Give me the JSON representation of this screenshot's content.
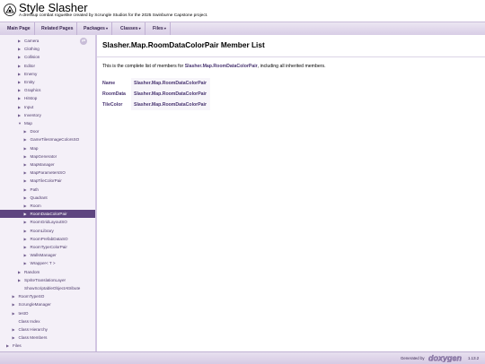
{
  "header": {
    "title": "Style Slasher",
    "subtitle": "A dressup combat roguelike created by Scrungle Studios for the 2025 Swinburne Capstone project."
  },
  "nav": {
    "main_page": "Main Page",
    "related_pages": "Related Pages",
    "packages": "Packages",
    "classes": "Classes",
    "files": "Files",
    "caret": "▾"
  },
  "sidebar": {
    "sync_icon": "⇄",
    "items": [
      {
        "label": "Camera",
        "arrow": "▶"
      },
      {
        "label": "Clothing",
        "arrow": "▶"
      },
      {
        "label": "Collision",
        "arrow": "▶"
      },
      {
        "label": "Editor",
        "arrow": "▶"
      },
      {
        "label": "Enemy",
        "arrow": "▶"
      },
      {
        "label": "Entity",
        "arrow": "▶"
      },
      {
        "label": "Graphics",
        "arrow": "▶"
      },
      {
        "label": "Hitstop",
        "arrow": "▶"
      },
      {
        "label": "Input",
        "arrow": "▶"
      },
      {
        "label": "Inventory",
        "arrow": "▶"
      },
      {
        "label": "Map",
        "arrow": "▼"
      },
      {
        "label": "Door",
        "arrow": "▶"
      },
      {
        "label": "GameTilesImageColorsSO",
        "arrow": "▶"
      },
      {
        "label": "Map",
        "arrow": "▶"
      },
      {
        "label": "MapGenerator",
        "arrow": "▶"
      },
      {
        "label": "MapManager",
        "arrow": "▶"
      },
      {
        "label": "MapParametersSO",
        "arrow": "▶"
      },
      {
        "label": "MapTileColorPair",
        "arrow": "▶"
      },
      {
        "label": "Path",
        "arrow": "▶"
      },
      {
        "label": "Quadrant",
        "arrow": "▶"
      },
      {
        "label": "Room",
        "arrow": "▶"
      },
      {
        "label": "RoomDataColorPair",
        "arrow": "▶"
      },
      {
        "label": "RoomGridLayoutSO",
        "arrow": "▶"
      },
      {
        "label": "RoomLibrary",
        "arrow": "▶"
      },
      {
        "label": "RoomPrefabDataSO",
        "arrow": "▶"
      },
      {
        "label": "RoomTypeColorPair",
        "arrow": "▶"
      },
      {
        "label": "WallsManager",
        "arrow": "▶"
      },
      {
        "label": "Wrapper< T >",
        "arrow": "▶"
      },
      {
        "label": "Random",
        "arrow": "▶"
      },
      {
        "label": "SpriteTranslationLayer",
        "arrow": "▶"
      },
      {
        "label": "ShowScriptableObjectAttribute",
        "arrow": ""
      },
      {
        "label": "RoomTypeSO",
        "arrow": "▶"
      },
      {
        "label": "ScrungleManager",
        "arrow": "▶"
      },
      {
        "label": "testO",
        "arrow": "▶"
      },
      {
        "label": "Class Index",
        "arrow": ""
      },
      {
        "label": "Class Hierarchy",
        "arrow": "▶"
      },
      {
        "label": "Class Members",
        "arrow": "▶"
      },
      {
        "label": "Files",
        "arrow": "▶"
      }
    ]
  },
  "main": {
    "title": "Slasher.Map.RoomDataColorPair Member List",
    "intro_prefix": "This is the complete list of members for ",
    "intro_link": "Slasher.Map.RoomDataColorPair",
    "intro_suffix": ", including all inherited members.",
    "members": [
      {
        "name": "Name",
        "owner": "Slasher.Map.RoomDataColorPair"
      },
      {
        "name": "RoomData",
        "owner": "Slasher.Map.RoomDataColorPair"
      },
      {
        "name": "TileColor",
        "owner": "Slasher.Map.RoomDataColorPair"
      }
    ]
  },
  "footer": {
    "generated_by": "Generated by",
    "logo_text": "doxygen",
    "version": "1.13.2"
  },
  "colors": {
    "accent": "#5e4580",
    "link": "#4a3672",
    "sidebar_bg": "#f4f0f8"
  }
}
